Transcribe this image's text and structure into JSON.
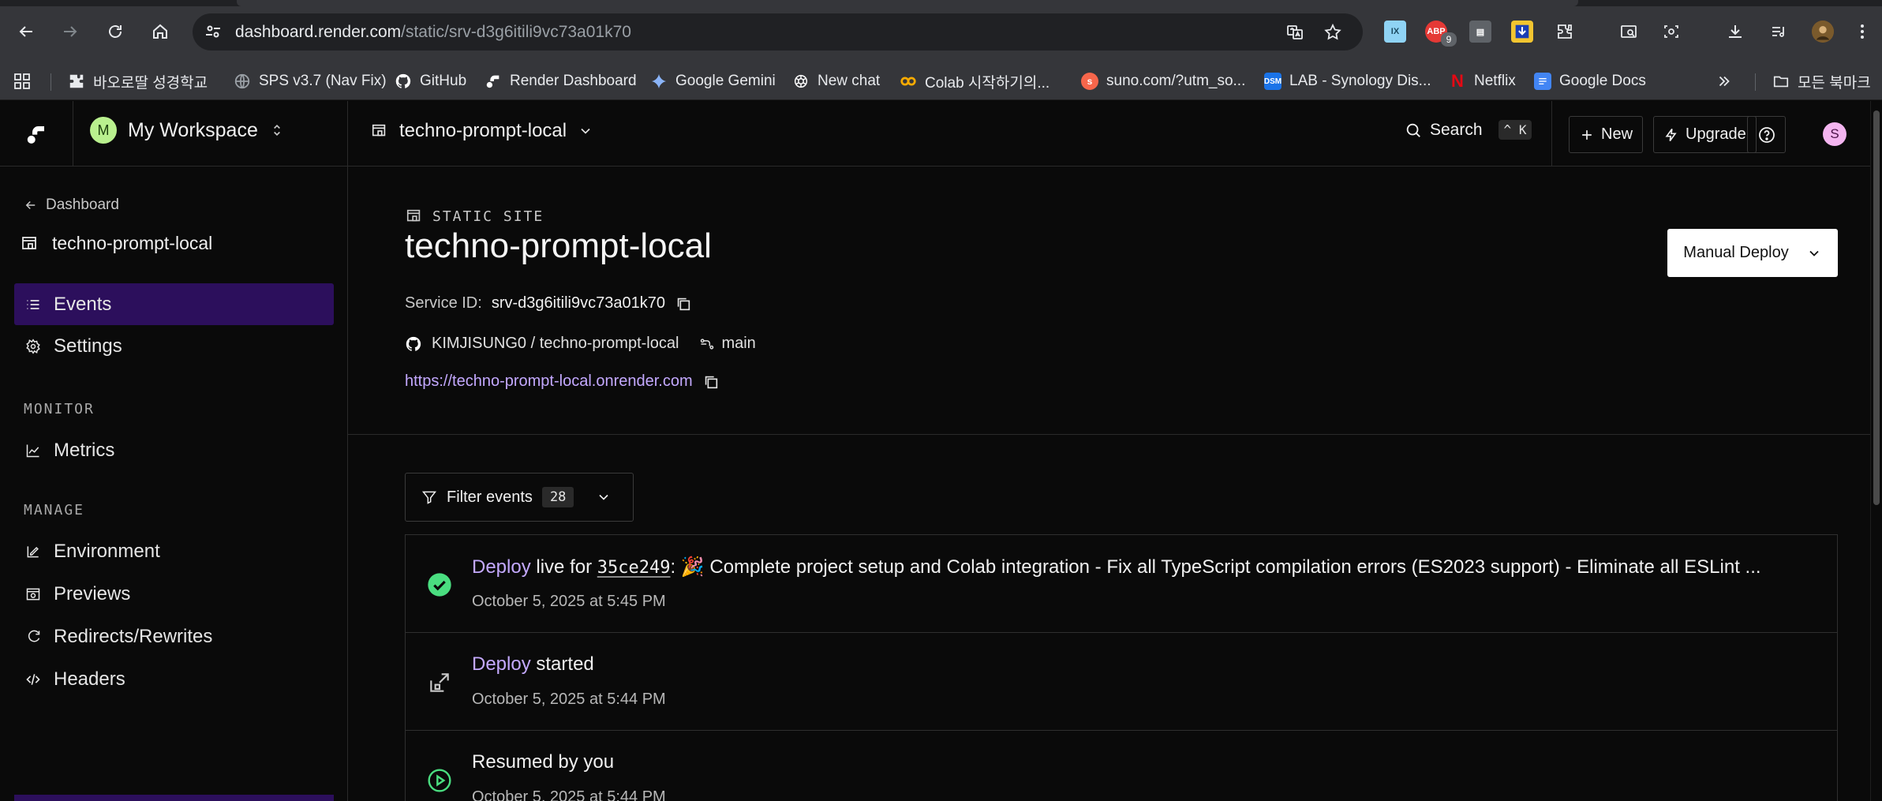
{
  "browser": {
    "url_host": "dashboard.render.com",
    "url_path": "/static/srv-d3g6itili9vc73a01k70",
    "extension_badge": "9",
    "bookmarks": [
      {
        "label": "바오로딸 성경학교",
        "icon": "puzzle-icon",
        "color": "#e8eaed"
      },
      {
        "label": "SPS v3.7 (Nav Fix)",
        "icon": "globe-icon",
        "color": "#9aa0a6"
      },
      {
        "label": "GitHub",
        "icon": "github-icon",
        "color": "#ffffff"
      },
      {
        "label": "Render Dashboard",
        "icon": "render-icon",
        "color": "#ffffff"
      },
      {
        "label": "Google Gemini",
        "icon": "gemini-icon",
        "color": "#8ab4f8"
      },
      {
        "label": "New chat",
        "icon": "openai-icon",
        "color": "#ffffff"
      },
      {
        "label": "Colab 시작하기의...",
        "icon": "colab-icon",
        "color": "#f9ab00"
      },
      {
        "label": "suno.com/?utm_so...",
        "icon": "suno-icon",
        "color": "#f7664b"
      },
      {
        "label": "LAB - Synology Dis...",
        "icon": "dsm-icon",
        "color": "#1a73e8"
      },
      {
        "label": "Netflix",
        "icon": "netflix-icon",
        "color": "#e50914"
      },
      {
        "label": "Google Docs",
        "icon": "docs-icon",
        "color": "#4285f4"
      }
    ],
    "bookmarks_folder": "모든 북마크"
  },
  "header": {
    "workspace_initial": "M",
    "workspace_name": "My Workspace",
    "service_name": "techno-prompt-local",
    "search_label": "Search",
    "search_shortcut": "^ K",
    "new_label": "New",
    "upgrade_label": "Upgrade",
    "user_initial": "S"
  },
  "sidebar": {
    "back_label": "Dashboard",
    "title": "techno-prompt-local",
    "items": [
      {
        "label": "Events",
        "icon": "list-icon",
        "active": true
      },
      {
        "label": "Settings",
        "icon": "gear-icon",
        "active": false
      }
    ],
    "monitor_label": "MONITOR",
    "monitor_items": [
      {
        "label": "Metrics",
        "icon": "chart-icon"
      }
    ],
    "manage_label": "MANAGE",
    "manage_items": [
      {
        "label": "Environment",
        "icon": "env-icon"
      },
      {
        "label": "Previews",
        "icon": "preview-icon"
      },
      {
        "label": "Redirects/Rewrites",
        "icon": "redirect-icon"
      },
      {
        "label": "Headers",
        "icon": "code-icon"
      }
    ]
  },
  "service": {
    "type_label": "STATIC SITE",
    "title": "techno-prompt-local",
    "id_label": "Service ID:",
    "id_value": "srv-d3g6itili9vc73a01k70",
    "repo": "KIMJISUNG0 / techno-prompt-local",
    "branch": "main",
    "url": "https://techno-prompt-local.onrender.com",
    "deploy_button": "Manual Deploy"
  },
  "filter": {
    "label": "Filter events",
    "count": "28"
  },
  "events": [
    {
      "status": "success",
      "accent": "Deploy",
      "mid": " live for ",
      "hash": "35ce249",
      "rest": ": 🎉 Complete project setup and Colab integration - Fix all TypeScript compilation errors (ES2023 support) - Eliminate all ESLint ...",
      "time": "October 5, 2025 at 5:45 PM"
    },
    {
      "status": "started",
      "accent": "Deploy",
      "mid": " started",
      "hash": "",
      "rest": "",
      "time": "October 5, 2025 at 5:44 PM"
    },
    {
      "status": "resumed",
      "accent": "",
      "mid": "Resumed by you",
      "hash": "",
      "rest": "",
      "time": "October 5, 2025 at 5:44 PM"
    }
  ],
  "colors": {
    "accent": "#c4a9ff",
    "active_nav": "#2c0f5c",
    "success": "#4ade80"
  }
}
